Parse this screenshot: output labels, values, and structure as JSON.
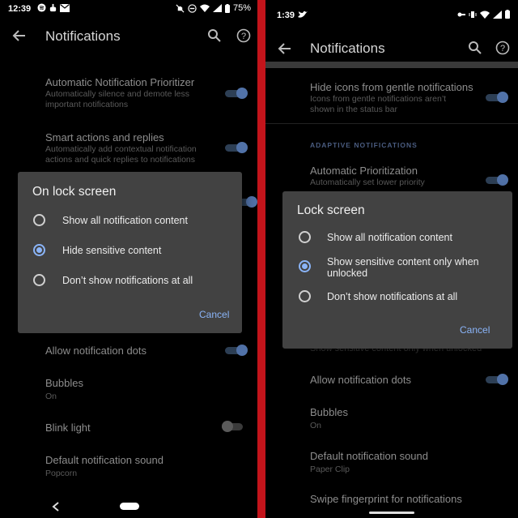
{
  "left": {
    "status": {
      "time": "12:39",
      "battery": "75%"
    },
    "appbar": {
      "title": "Notifications"
    },
    "rows": [
      {
        "title": "Automatic Notification Prioritizer",
        "subtitle": "Automatically silence and demote less important notifications"
      },
      {
        "title": "Smart actions and replies",
        "subtitle": "Automatically add contextual notification actions and quick replies to notifications"
      },
      {
        "title": "Allow notification dots"
      },
      {
        "title": "Bubbles",
        "subtitle": "On"
      },
      {
        "title": "Blink light"
      },
      {
        "title": "Default notification sound",
        "subtitle": "Popcorn"
      }
    ],
    "dialog": {
      "title": "On lock screen",
      "options": [
        "Show all notification content",
        "Hide sensitive content",
        "Don’t show notifications at all"
      ],
      "selected": 1,
      "cancel": "Cancel"
    }
  },
  "right": {
    "status": {
      "time": "1:39"
    },
    "appbar": {
      "title": "Notifications"
    },
    "rows": [
      {
        "title": "Hide icons from gentle notifications",
        "subtitle": "Icons from gentle notifications aren’t shown in the status bar"
      },
      {
        "title": "Automatic Prioritization",
        "subtitle": "Automatically set lower priority"
      },
      {
        "title": "Show sensitive content only when unlocked"
      },
      {
        "title": "Allow notification dots"
      },
      {
        "title": "Bubbles",
        "subtitle": "On"
      },
      {
        "title": "Default notification sound",
        "subtitle": "Paper Clip"
      },
      {
        "title": "Swipe fingerprint for notifications"
      }
    ],
    "section_label": "ADAPTIVE NOTIFICATIONS",
    "dialog": {
      "title": "Lock screen",
      "options": [
        "Show all notification content",
        "Show sensitive content only when unlocked",
        "Don’t show notifications at all"
      ],
      "selected": 1,
      "cancel": "Cancel"
    }
  },
  "colors": {
    "accent": "#8ab4f8",
    "divider": "#c3141b",
    "dialog_bg": "#424242"
  },
  "icons": [
    "back-arrow-icon",
    "search-icon",
    "help-icon",
    "wifi-icon",
    "battery-icon",
    "radio-button-icon",
    "twitter-icon"
  ]
}
